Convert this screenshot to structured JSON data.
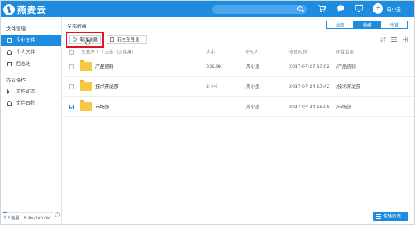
{
  "app": {
    "brand": "燕麦云"
  },
  "topbar": {
    "icons": [
      "cart-icon",
      "chat-icon",
      "monitor-icon",
      "user-icon"
    ],
    "user_name": "周小麦"
  },
  "sidebar": {
    "sections": [
      {
        "title": "文件管理",
        "items": [
          {
            "label": "企业文件",
            "icon": "folder-icon",
            "active": true
          },
          {
            "label": "个人文件",
            "icon": "person-icon",
            "active": false
          },
          {
            "label": "回收站",
            "icon": "trash-icon",
            "active": false
          }
        ]
      },
      {
        "title": "办公协作",
        "items": [
          {
            "label": "文件动态",
            "icon": "speaker-icon",
            "active": false
          },
          {
            "label": "文件审批",
            "icon": "person-icon",
            "active": false
          }
        ]
      }
    ],
    "quota_text": "个人容量：8.9M/100.0M",
    "quota_fraction": 0.09
  },
  "main": {
    "breadcrumb": "全部收藏",
    "filter_tabs": [
      {
        "label": "全部",
        "active": false
      },
      {
        "label": "收藏",
        "active": true
      },
      {
        "label": "外链",
        "active": false
      }
    ],
    "toolbar": {
      "unfavorite_label": "取消收藏",
      "open_dir_label": "前往至目录"
    },
    "table": {
      "headers": {
        "name": "已选择 1 个文件（文件夹）",
        "size": "大小",
        "modifier": "修改人",
        "time": "修改时间",
        "location": "所在目录"
      },
      "rows": [
        {
          "name": "产品资料",
          "size": "339.9K",
          "modifier": "周小麦",
          "time": "2017-07-27 17:02",
          "location": "/产品资料",
          "checked": false
        },
        {
          "name": "技术开发部",
          "size": "2.4M",
          "modifier": "周小麦",
          "time": "2017-07-24 17:42",
          "location": "/技术开发部",
          "checked": false
        },
        {
          "name": "市场部",
          "size": "-",
          "modifier": "周小麦",
          "time": "2017-07-24 16:08",
          "location": "/市场部",
          "checked": true
        }
      ]
    },
    "transfer_label": "传输列表"
  },
  "colors": {
    "accent": "#1d8ce0",
    "highlight": "#e0141e",
    "folder": "#f7c843"
  }
}
